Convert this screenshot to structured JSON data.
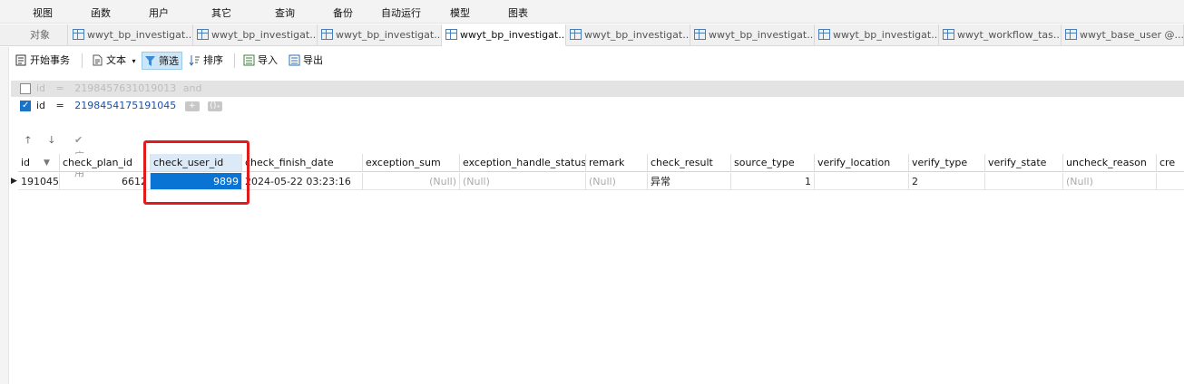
{
  "menu": [
    "视图",
    "函数",
    "用户",
    "其它",
    "查询",
    "备份",
    "自动运行",
    "模型",
    "图表"
  ],
  "tabs": {
    "objects_label": "对象",
    "items": [
      {
        "label": "wwyt_bp_investigat...",
        "active": false
      },
      {
        "label": "wwyt_bp_investigat...",
        "active": false
      },
      {
        "label": "wwyt_bp_investigat...",
        "active": false
      },
      {
        "label": "wwyt_bp_investigat...",
        "active": true
      },
      {
        "label": "wwyt_bp_investigat...",
        "active": false
      },
      {
        "label": "wwyt_bp_investigat...",
        "active": false
      },
      {
        "label": "wwyt_bp_investigat...",
        "active": false
      },
      {
        "label": "wwyt_workflow_tas...",
        "active": false
      },
      {
        "label": "wwyt_base_user @...",
        "active": false
      }
    ]
  },
  "toolbar": {
    "begin_transaction": "开始事务",
    "text": "文本",
    "filter": "筛选",
    "sort": "排序",
    "import": "导入",
    "export": "导出"
  },
  "filter": {
    "row1": {
      "checked": false,
      "field": "id",
      "op": "=",
      "value": "2198457631019013",
      "suffix": "and"
    },
    "row2": {
      "checked": true,
      "field": "id",
      "op": "=",
      "value": "2198454175191045"
    }
  },
  "actions": {
    "apply": "应用"
  },
  "grid": {
    "columns": [
      "id",
      "check_plan_id",
      "check_user_id",
      "check_finish_date",
      "exception_sum",
      "exception_handle_status",
      "remark",
      "check_result",
      "source_type",
      "verify_location",
      "verify_type",
      "verify_state",
      "uncheck_reason",
      "cre"
    ],
    "row": {
      "id": "191045",
      "check_plan_id": "6612",
      "check_user_id": "9899",
      "check_finish_date": "2024-05-22 03:23:16",
      "exception_sum": "(Null)",
      "exception_handle_status": "(Null)",
      "remark": "(Null)",
      "check_result": "异常",
      "source_type": "1",
      "verify_location": "",
      "verify_type": "2",
      "verify_state": "",
      "uncheck_reason": "(Null)",
      "cre": ""
    }
  },
  "colors": {
    "selection": "#0a74d4",
    "highlight_box": "#e11b1b"
  }
}
